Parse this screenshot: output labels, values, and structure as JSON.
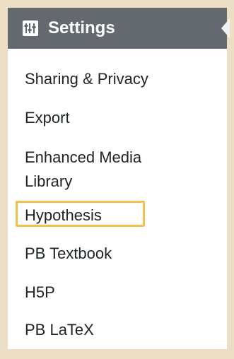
{
  "colors": {
    "frame": "#ecdec5",
    "header_bg": "#646970",
    "header_text": "#ffffff",
    "menu_text": "#1d2327",
    "highlight": "#f2c14a"
  },
  "header": {
    "icon": "settings-sliders-icon",
    "title": "Settings"
  },
  "submenu": {
    "items": [
      {
        "label": "Sharing & Privacy"
      },
      {
        "label": "Export"
      },
      {
        "label": "Enhanced Media Library"
      },
      {
        "label": "Hypothesis",
        "highlighted": true
      },
      {
        "label": "PB Textbook"
      },
      {
        "label": "H5P"
      },
      {
        "label": "PB LaTeX"
      }
    ]
  }
}
